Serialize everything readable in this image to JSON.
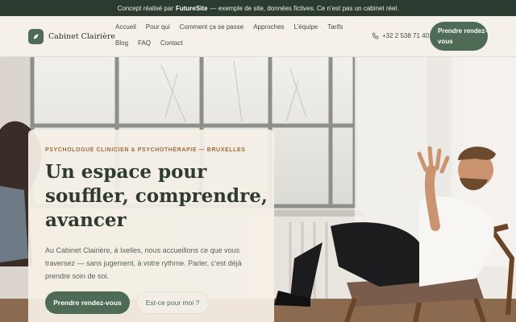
{
  "notice": {
    "prefix": "Concept réalisé par",
    "brand": "FutureSite",
    "suffix": "— exemple de site, données fictives. Ce n’est pas un cabinet réel."
  },
  "header": {
    "logo_text": "Cabinet Clairière",
    "logo_icon": "leaf-icon",
    "nav": [
      "Accueil",
      "Pour qui",
      "Comment ça se passe",
      "Approches",
      "L’équipe",
      "Tarifs",
      "Blog",
      "FAQ",
      "Contact"
    ],
    "phone": "+32 2 538 71 40",
    "phone_icon": "phone-icon",
    "cta": "Prendre rendez-vous"
  },
  "hero": {
    "eyebrow": "PSYCHOLOGUE CLINICIEN & PSYCHOTHÉRAPIE — BRUXELLES",
    "title": "Un espace pour souffler, comprendre, avancer",
    "lede": "Au Cabinet Clairière, à Ixelles, nous accueillons ce que vous traversez — sans jugement, à votre rythme. Parler, c’est déjà prendre soin de soi.",
    "primary_cta": "Prendre rendez-vous",
    "secondary_cta": "Est-ce pour moi ?"
  },
  "colors": {
    "accent": "#4d6b55",
    "notice_bar": "#2c3b2f",
    "eyebrow": "#a06a3c",
    "heading": "#2f3a33"
  }
}
